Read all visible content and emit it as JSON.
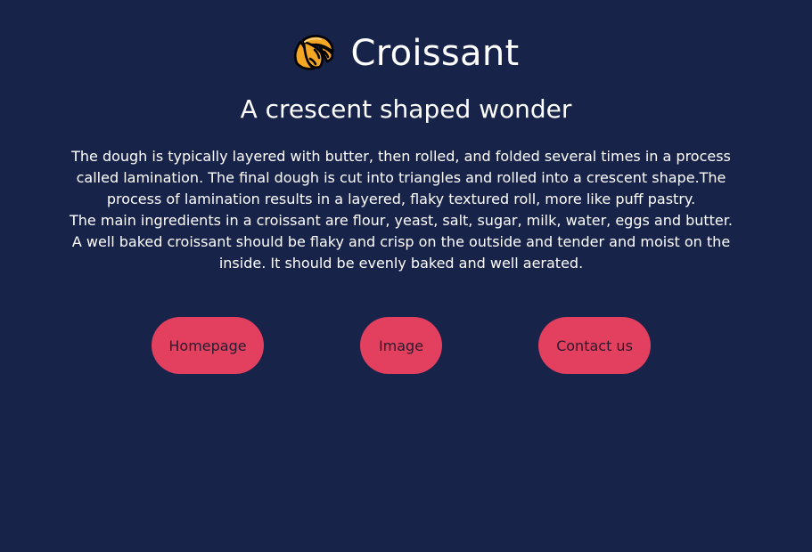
{
  "header": {
    "logo_icon": "croissant-icon",
    "title": "Croissant"
  },
  "subtitle": "A crescent shaped wonder",
  "description": {
    "paragraph_1": "The dough is typically layered with butter, then rolled, and folded several times in a process called lamination. The final dough is cut into triangles and rolled into a crescent shape.The process of lamination results in a layered, flaky textured roll, more like puff pastry.",
    "paragraph_2": "The main ingredients in a croissant are flour, yeast, salt, sugar, milk, water, eggs and butter.",
    "paragraph_3": "A well baked croissant should be flaky and crisp on the outside and tender and moist on the inside. It should be evenly baked and well aerated."
  },
  "nav": {
    "homepage_label": "Homepage",
    "image_label": "Image",
    "contact_label": "Contact us"
  },
  "colors": {
    "background": "#172349",
    "button": "#e33f5e",
    "button_text": "#2a1b2e",
    "text": "#ffffff",
    "croissant_fill": "#f5a623"
  }
}
